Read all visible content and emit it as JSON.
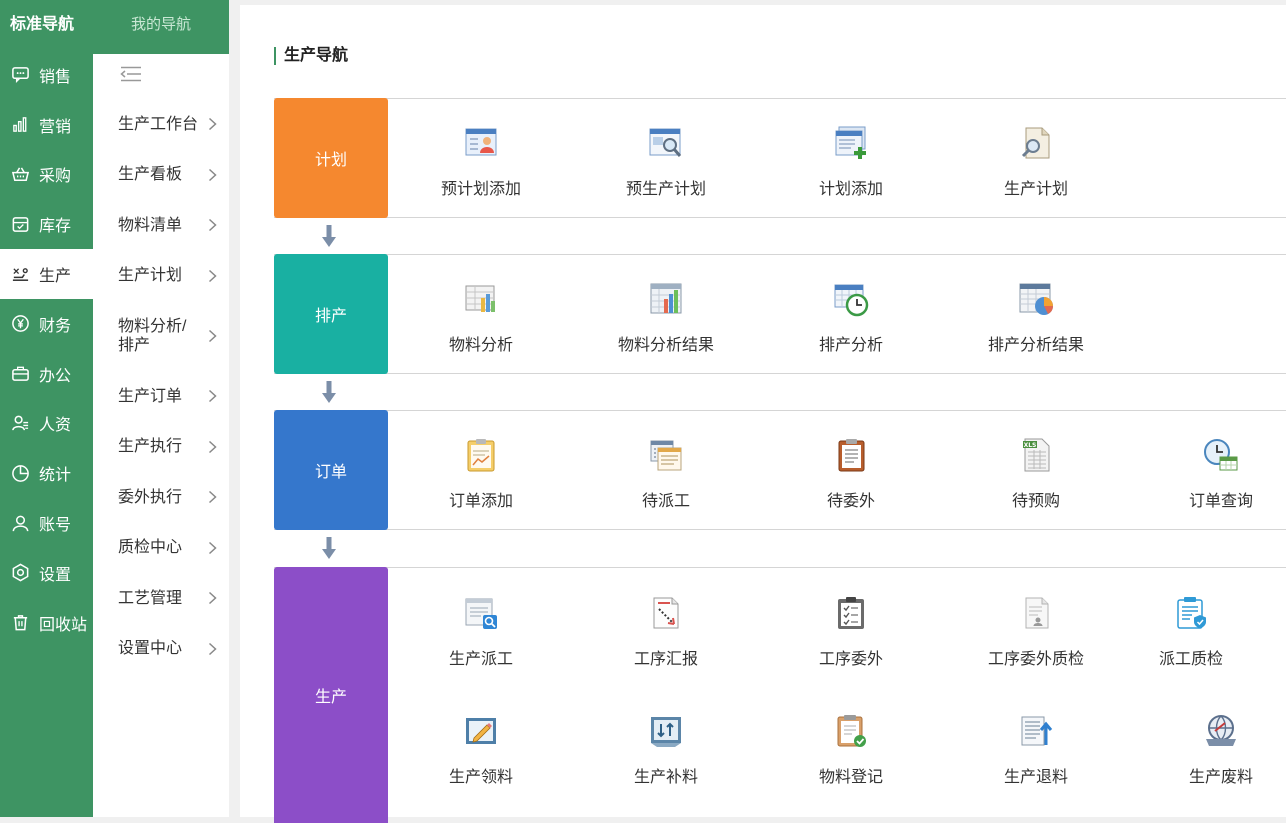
{
  "main_nav": {
    "brand": "标准导航",
    "items": [
      {
        "label": "销售",
        "icon": "chat-icon"
      },
      {
        "label": "营销",
        "icon": "bar-chart-icon"
      },
      {
        "label": "采购",
        "icon": "basket-icon"
      },
      {
        "label": "库存",
        "icon": "inventory-icon"
      },
      {
        "label": "生产",
        "icon": "factory-icon"
      },
      {
        "label": "财务",
        "icon": "yen-icon"
      },
      {
        "label": "办公",
        "icon": "briefcase-icon"
      },
      {
        "label": "人资",
        "icon": "user-list-icon"
      },
      {
        "label": "统计",
        "icon": "pie-icon"
      },
      {
        "label": "账号",
        "icon": "person-icon"
      },
      {
        "label": "设置",
        "icon": "hexagon-gear-icon"
      },
      {
        "label": "回收站",
        "icon": "trash-icon"
      }
    ],
    "active": "生产"
  },
  "sub_nav": {
    "header": "我的导航",
    "items": [
      "生产工作台",
      "生产看板",
      "物料清单",
      "生产计划",
      "物料分析/排产",
      "生产订单",
      "生产执行",
      "委外执行",
      "质检中心",
      "工艺管理",
      "设置中心"
    ]
  },
  "content": {
    "title": "生产导航",
    "sections": [
      {
        "tag": "计划",
        "color": "#f5882f",
        "items": [
          "预计划添加",
          "预生产计划",
          "计划添加",
          "生产计划"
        ]
      },
      {
        "tag": "排产",
        "color": "#19b0a2",
        "items": [
          "物料分析",
          "物料分析结果",
          "排产分析",
          "排产分析结果"
        ]
      },
      {
        "tag": "订单",
        "color": "#3577cc",
        "items": [
          "订单添加",
          "待派工",
          "待委外",
          "待预购",
          "订单查询"
        ]
      },
      {
        "tag": "生产",
        "color": "#8c4ec8",
        "items": [
          "生产派工",
          "工序汇报",
          "工序委外",
          "工序委外质检",
          "派工质检",
          "生产领料",
          "生产补料",
          "物料登记",
          "生产退料",
          "生产废料"
        ]
      }
    ],
    "xls_label": "XLS"
  },
  "colors": {
    "green": "#3e9463",
    "arrow": "#7b8ea8"
  }
}
